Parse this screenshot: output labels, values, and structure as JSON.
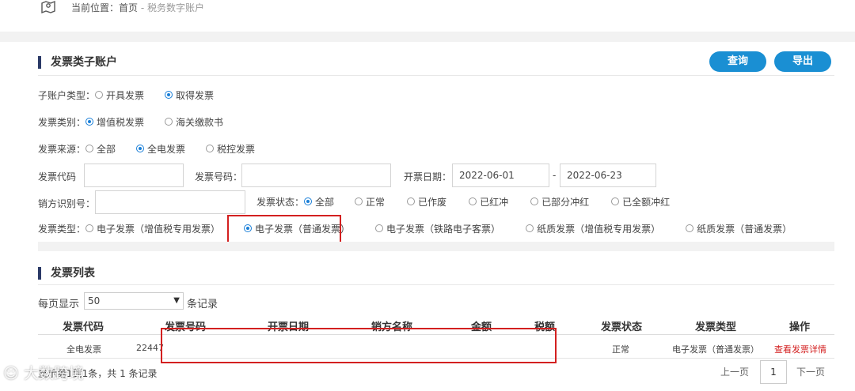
{
  "breadcrumb": {
    "label": "当前位置：",
    "home": "首页",
    "separator": " - ",
    "current": "税务数字账户"
  },
  "panel": {
    "title": "发票类子账户",
    "query_button": "查询",
    "export_button": "导出"
  },
  "filters": {
    "account_type": {
      "label": "子账户类型：",
      "options": [
        "开具发票",
        "取得发票"
      ],
      "selected": "取得发票"
    },
    "invoice_category": {
      "label": "发票类别：",
      "options": [
        "增值税发票",
        "海关缴款书"
      ],
      "selected": "增值税发票"
    },
    "invoice_source": {
      "label": "发票来源：",
      "options": [
        "全部",
        "全电发票",
        "税控发票"
      ],
      "selected": "全电发票"
    },
    "invoice_code": {
      "label": "发票代码",
      "value": ""
    },
    "invoice_number": {
      "label": "发票号码：",
      "value": ""
    },
    "issue_date": {
      "label": "开票日期：",
      "from": "2022-06-01",
      "separator": "-",
      "to": "2022-06-23"
    },
    "seller_id": {
      "label": "销方识别号：",
      "value": ""
    },
    "invoice_status": {
      "label": "发票状态：",
      "options": [
        "全部",
        "正常",
        "已作废",
        "已红冲",
        "已部分冲红",
        "已全额冲红"
      ],
      "selected": "全部"
    },
    "invoice_type": {
      "label": "发票类型：",
      "options": [
        "电子发票（增值税专用发票）",
        "电子发票（普通发票）",
        "电子发票（铁路电子客票）",
        "纸质发票（增值税专用发票）",
        "纸质发票（普通发票）"
      ],
      "selected": "电子发票（普通发票）"
    }
  },
  "list": {
    "title": "发票列表",
    "page_size_prefix": "每页显示",
    "page_size": "50",
    "page_size_suffix": "条记录",
    "columns": [
      "发票代码",
      "发票号码",
      "开票日期",
      "销方名称",
      "金额",
      "税额",
      "发票状态",
      "发票类型",
      "操作"
    ],
    "rows": [
      {
        "code": "全电发票",
        "number": "22447",
        "status": "正常",
        "type": "电子发票（普通发票）",
        "action": "查看发票详情"
      }
    ],
    "summary": "显示第1到1条，共 1 条记录",
    "prev": "上一页",
    "current_page": "1",
    "next": "下一页"
  },
  "watermark": "大数跨境",
  "colors": {
    "primary": "#1a8fd3",
    "highlight": "#d32020",
    "title_bar": "#2b3a67"
  }
}
